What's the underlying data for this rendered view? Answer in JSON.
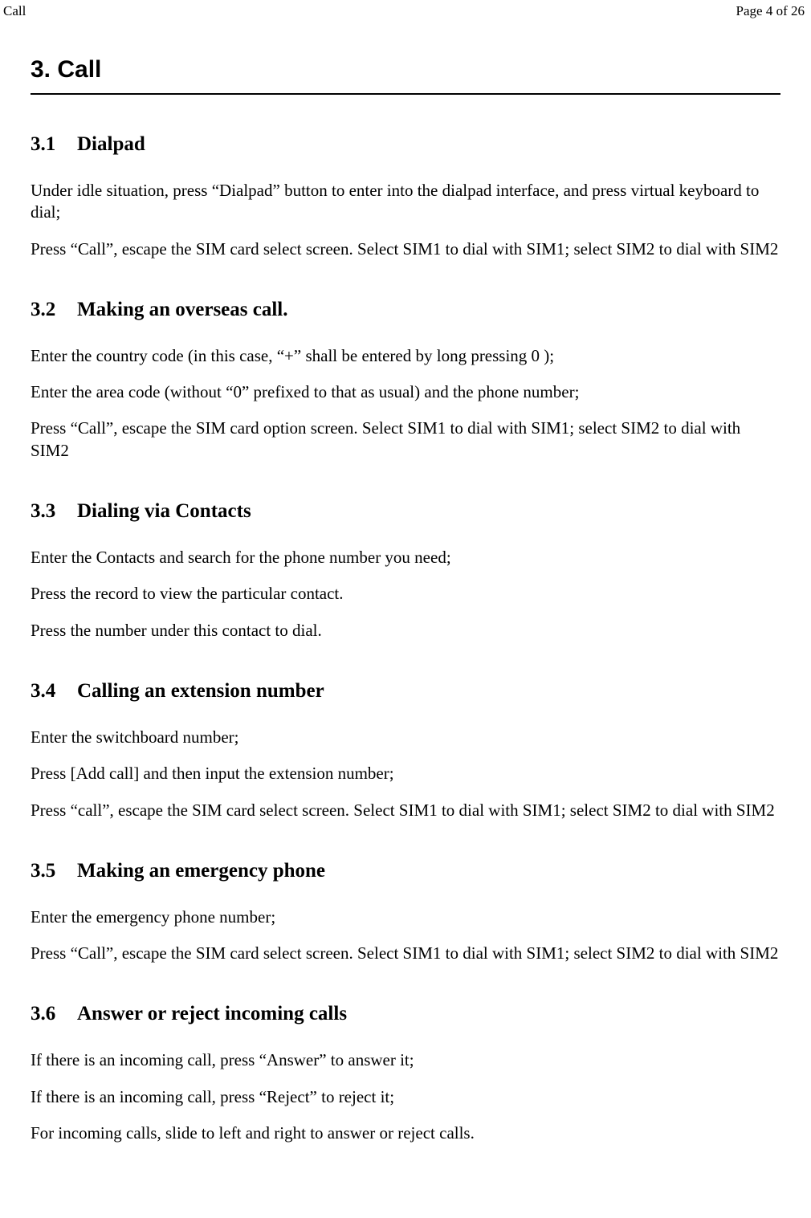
{
  "header": {
    "left": "Call",
    "right": "Page 4 of 26"
  },
  "chapter": {
    "title": "3. Call"
  },
  "sections": {
    "s1": {
      "num": "3.1",
      "title": "Dialpad",
      "p1": "Under idle situation, press “Dialpad” button to enter into the dialpad interface, and press virtual keyboard to dial;",
      "p2": "Press “Call”, escape the SIM card select screen. Select SIM1 to dial with SIM1; select SIM2 to dial with SIM2"
    },
    "s2": {
      "num": "3.2",
      "title": "Making an overseas call.",
      "p1": "Enter the country code (in this case, “+” shall be entered by long pressing 0 );",
      "p2": "Enter the area code (without “0” prefixed to that as usual) and the phone number;",
      "p3": "Press “Call”, escape the SIM card option screen. Select SIM1 to dial with SIM1; select SIM2 to dial with SIM2"
    },
    "s3": {
      "num": "3.3",
      "title": "Dialing via Contacts",
      "p1": "Enter the Contacts and search for the phone number you need;",
      "p2": "Press the record to view the particular contact.",
      "p3": "Press the number under this contact to dial."
    },
    "s4": {
      "num": "3.4",
      "title": "Calling an extension number",
      "p1": "Enter the switchboard number;",
      "p2": "Press [Add call] and then input the extension number;",
      "p3": "Press “call”, escape the SIM card select screen. Select SIM1 to dial with SIM1; select SIM2 to dial with SIM2"
    },
    "s5": {
      "num": "3.5",
      "title": "Making an emergency phone",
      "p1": "Enter the emergency phone number;",
      "p2": "Press “Call”, escape the SIM card select screen. Select SIM1 to dial with SIM1; select SIM2 to dial with SIM2"
    },
    "s6": {
      "num": "3.6",
      "title": "Answer or reject incoming calls",
      "p1": "If there is an incoming call, press “Answer” to answer it;",
      "p2": "If there is an incoming call, press “Reject” to reject it;",
      "p3": "For incoming calls, slide to left and right to answer or reject calls."
    }
  }
}
